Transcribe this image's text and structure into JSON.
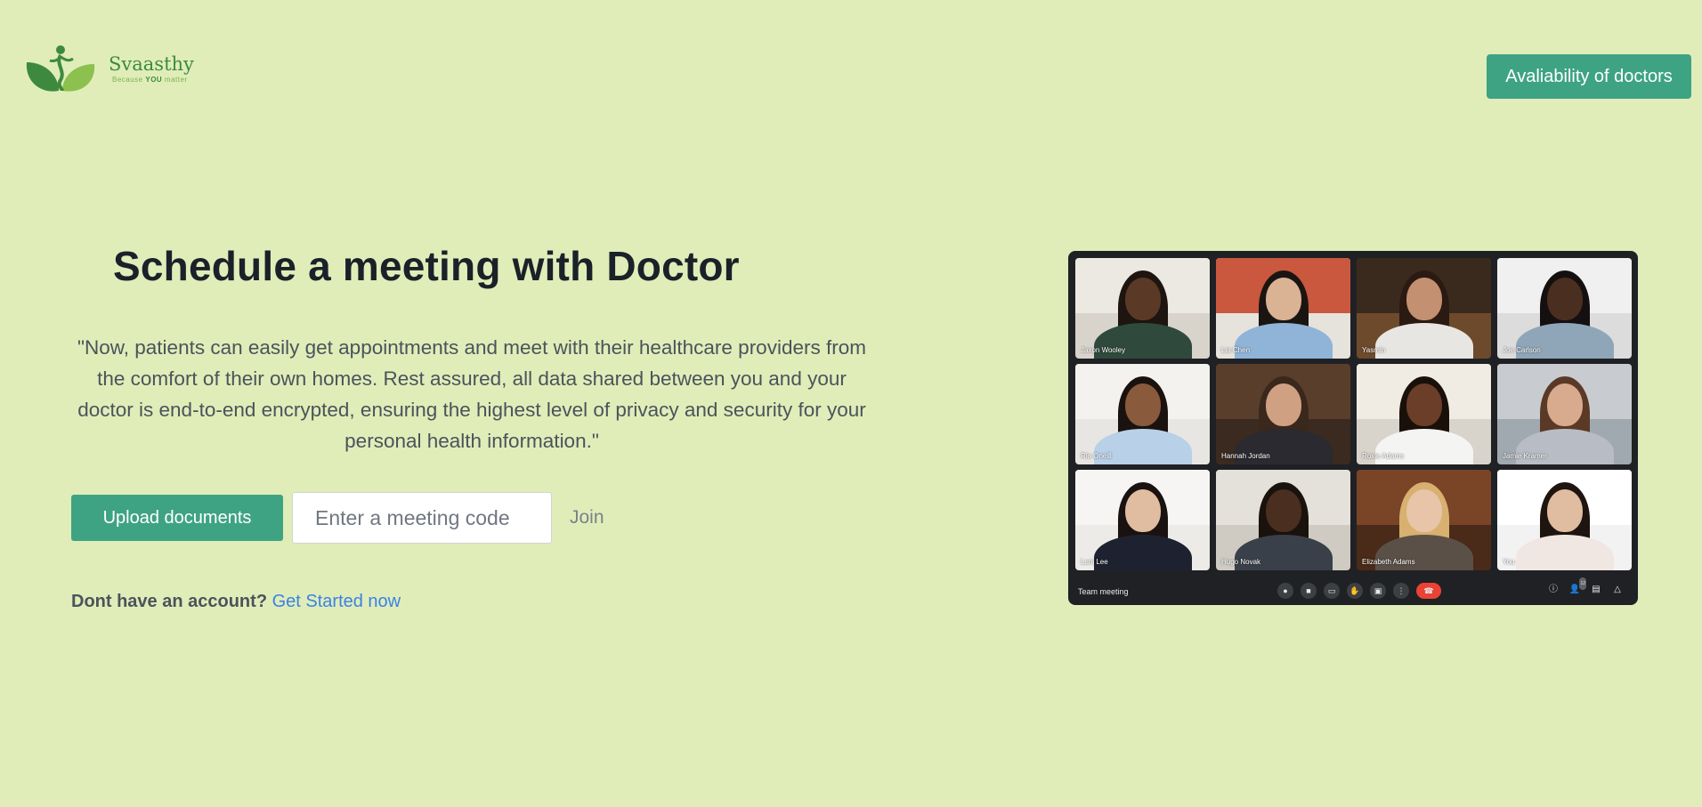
{
  "brand": {
    "name": "Svaasthy",
    "tagline_prefix": "Because ",
    "tagline_emphasis": "YOU",
    "tagline_suffix": " matter",
    "primary_color": "#3ea383",
    "background_color": "#e0edb9"
  },
  "header": {
    "availability_button": "Avaliability of doctors"
  },
  "hero": {
    "title": "Schedule a meeting with Doctor",
    "description": "\"Now, patients can easily get appointments and meet with their healthcare providers from the comfort of their own homes. Rest assured, all data shared between you and your doctor is end-to-end encrypted, ensuring the highest level of privacy and security for your personal health information.\"",
    "upload_button": "Upload documents",
    "meeting_code_placeholder": "Enter a meeting code",
    "join_button": "Join",
    "signup_prompt": "Dont have an account?",
    "signup_link": "Get Started now"
  },
  "meeting_preview": {
    "title": "Team meeting",
    "participants": [
      {
        "name": "Jaxon Wooley"
      },
      {
        "name": "Lia Chen"
      },
      {
        "name": "Yasmin"
      },
      {
        "name": "Joe Carlson"
      },
      {
        "name": "Ria Oneill"
      },
      {
        "name": "Hannah Jordan"
      },
      {
        "name": "Roxie Adams"
      },
      {
        "name": "Jamie Kramer"
      },
      {
        "name": "Lani Lee"
      },
      {
        "name": "Hugo Novak"
      },
      {
        "name": "Elizabeth Adams"
      },
      {
        "name": "You"
      }
    ],
    "people_count": "12"
  }
}
